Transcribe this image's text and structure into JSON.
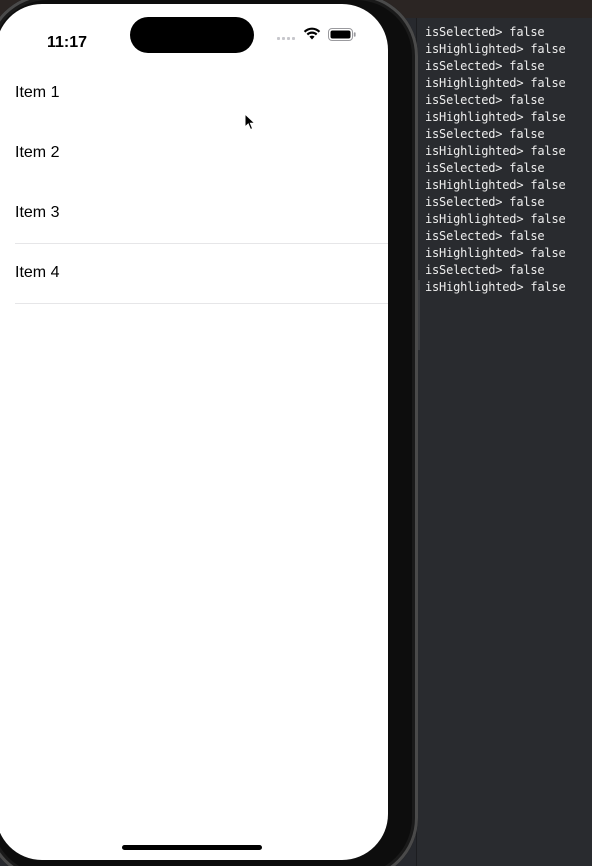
{
  "status_bar": {
    "time": "11:17"
  },
  "list": {
    "items": [
      {
        "label": "Item 1"
      },
      {
        "label": "Item 2"
      },
      {
        "label": "Item 3"
      },
      {
        "label": "Item 4"
      }
    ]
  },
  "console": {
    "lines": [
      "isSelected> false",
      "isHighlighted> false",
      "isSelected> false",
      "isHighlighted> false",
      "isSelected> false",
      "isHighlighted> false",
      "isSelected> false",
      "isHighlighted> false",
      "isSelected> false",
      "isHighlighted> false",
      "isSelected> false",
      "isHighlighted> false",
      "isSelected> false",
      "isHighlighted> false",
      "isSelected> false",
      "isHighlighted> false"
    ]
  },
  "colors": {
    "console_background": "#292b2f",
    "console_text": "#eeeeee",
    "screen_background": "#ffffff",
    "separator": "#e6e6e8"
  },
  "icons": {
    "wifi": "wifi-icon",
    "battery": "battery-icon",
    "signal": "cellular-signal-icon",
    "cursor": "mouse-pointer-icon"
  }
}
